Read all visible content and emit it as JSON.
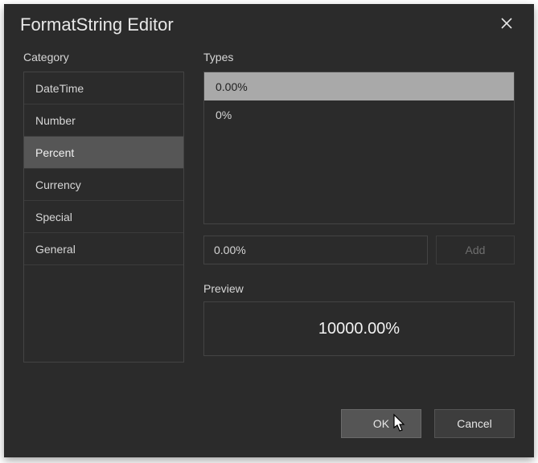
{
  "dialog": {
    "title": "FormatString Editor",
    "close_icon": "close"
  },
  "category": {
    "label": "Category",
    "items": [
      {
        "label": "DateTime",
        "selected": false
      },
      {
        "label": "Number",
        "selected": false
      },
      {
        "label": "Percent",
        "selected": true
      },
      {
        "label": "Currency",
        "selected": false
      },
      {
        "label": "Special",
        "selected": false
      },
      {
        "label": "General",
        "selected": false
      }
    ]
  },
  "types": {
    "label": "Types",
    "items": [
      {
        "label": "0.00%",
        "selected": true
      },
      {
        "label": "0%",
        "selected": false
      }
    ],
    "input_value": "0.00%",
    "add_label": "Add"
  },
  "preview": {
    "label": "Preview",
    "value": "10000.00%"
  },
  "footer": {
    "ok_label": "OK",
    "cancel_label": "Cancel"
  }
}
